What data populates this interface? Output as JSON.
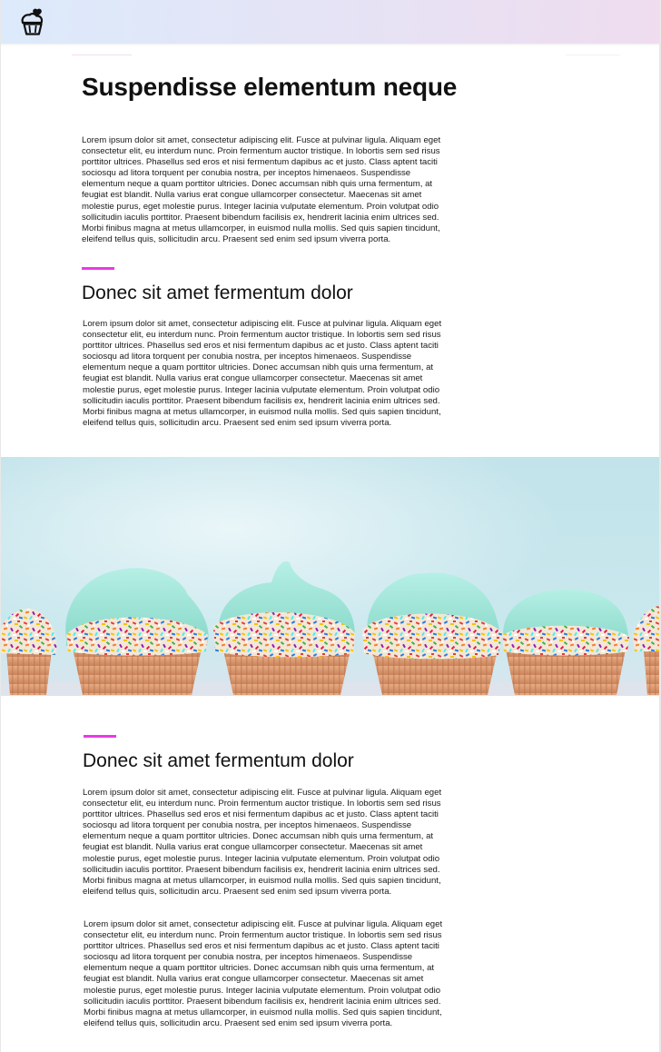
{
  "header": {
    "logo_icon": "cupcake-icon"
  },
  "article": {
    "title": "Suspendisse elementum neque",
    "intro_paragraph": "Lorem ipsum dolor sit amet, consectetur adipiscing elit. Fusce at pulvinar ligula. Aliquam eget consectetur elit, eu interdum nunc. Proin fermentum auctor tristique. In lobortis sem sed risus porttitor ultrices. Phasellus sed eros et nisi fermentum dapibus ac et justo. Class aptent taciti sociosqu ad litora torquent per conubia nostra, per inceptos himenaeos. Suspendisse elementum neque a quam porttitor ultricies. Donec accumsan nibh quis urna fermentum, at feugiat est blandit. Nulla varius erat congue ullamcorper consectetur. Maecenas sit amet molestie purus, eget molestie purus. Integer lacinia vulputate elementum. Proin volutpat odio sollicitudin iaculis porttitor. Praesent bibendum facilisis ex, hendrerit lacinia enim ultrices sed. Morbi finibus magna at metus ullamcorper, in euismod nulla mollis. Sed quis sapien tincidunt, eleifend tellus quis, sollicitudin arcu. Praesent sed enim sed ipsum viverra porta.",
    "section1": {
      "heading": "Donec sit amet fermentum dolor",
      "paragraph": "Lorem ipsum dolor sit amet, consectetur adipiscing elit. Fusce at pulvinar ligula. Aliquam eget consectetur elit, eu interdum nunc. Proin fermentum auctor tristique. In lobortis sem sed risus porttitor ultrices. Phasellus sed eros et nisi fermentum dapibus ac et justo. Class aptent taciti sociosqu ad litora torquent per conubia nostra, per inceptos himenaeos. Suspendisse elementum neque a quam porttitor ultricies. Donec accumsan nibh quis urna fermentum, at feugiat est blandit. Nulla varius erat congue ullamcorper consectetur. Maecenas sit amet molestie purus, eget molestie purus. Integer lacinia vulputate elementum. Proin volutpat odio sollicitudin iaculis porttitor. Praesent bibendum facilisis ex, hendrerit lacinia enim ultrices sed. Morbi finibus magna at metus ullamcorper, in euismod nulla mollis. Sed quis sapien tincidunt, eleifend tellus quis, sollicitudin arcu. Praesent sed enim sed ipsum viverra porta."
    },
    "section2": {
      "heading": "Donec sit amet fermentum dolor",
      "paragraph_1": "Lorem ipsum dolor sit amet, consectetur adipiscing elit. Fusce at pulvinar ligula. Aliquam eget consectetur elit, eu interdum nunc. Proin fermentum auctor tristique. In lobortis sem sed risus porttitor ultrices. Phasellus sed eros et nisi fermentum dapibus ac et justo. Class aptent taciti sociosqu ad litora torquent per conubia nostra, per inceptos himenaeos. Suspendisse elementum neque a quam porttitor ultricies. Donec accumsan nibh quis urna fermentum, at feugiat est blandit. Nulla varius erat congue ullamcorper consectetur. Maecenas sit amet molestie purus, eget molestie purus. Integer lacinia vulputate elementum. Proin volutpat odio sollicitudin iaculis porttitor. Praesent bibendum facilisis ex, hendrerit lacinia enim ultrices sed. Morbi finibus magna at metus ullamcorper, in euismod nulla mollis. Sed quis sapien tincidunt, eleifend tellus quis, sollicitudin arcu. Praesent sed enim sed ipsum viverra porta.",
      "paragraph_2": "Lorem ipsum dolor sit amet, consectetur adipiscing elit. Fusce at pulvinar ligula. Aliquam eget consectetur elit, eu interdum nunc. Proin fermentum auctor tristique. In lobortis sem sed risus porttitor ultrices. Phasellus sed eros et nisi fermentum dapibus ac et justo. Class aptent taciti sociosqu ad litora torquent per conubia nostra, per inceptos himenaeos. Suspendisse elementum neque a quam porttitor ultricies. Donec accumsan nibh quis urna fermentum, at feugiat est blandit. Nulla varius erat congue ullamcorper consectetur. Maecenas sit amet molestie purus, eget molestie purus. Integer lacinia vulputate elementum. Proin volutpat odio sollicitudin iaculis porttitor. Praesent bibendum facilisis ex, hendrerit lacinia enim ultrices sed. Morbi finibus magna at metus ullamcorper, in euismod nulla mollis. Sed quis sapien tincidunt, eleifend tellus quis, sollicitudin arcu. Praesent sed enim sed ipsum viverra porta."
    }
  },
  "hero_image": {
    "subject": "cupcakes-photo"
  },
  "colors": {
    "accent": "#e83ae6",
    "header_gradient_start": "#dceafb",
    "header_gradient_end": "#efdcef",
    "frosting": "#9fe3d6",
    "hero_background": "#c4e6ec"
  }
}
